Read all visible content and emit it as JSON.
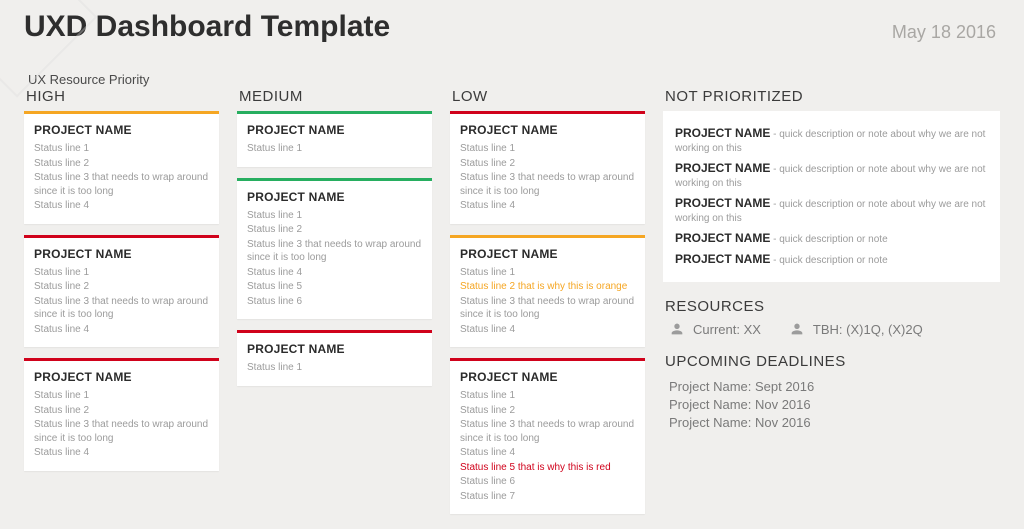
{
  "header": {
    "title": "UXD Dashboard Template",
    "date": "May 18 2016"
  },
  "section_label": "UX Resource Priority",
  "columns": {
    "high": {
      "title": "HIGH",
      "cards": [
        {
          "color": "orange",
          "name": "PROJECT NAME",
          "lines": [
            {
              "t": "Status line 1"
            },
            {
              "t": "Status line 2"
            },
            {
              "t": "Status line 3 that needs to wrap around since it is too long"
            },
            {
              "t": "Status line 4"
            }
          ]
        },
        {
          "color": "red",
          "name": "PROJECT NAME",
          "lines": [
            {
              "t": "Status line 1"
            },
            {
              "t": "Status line 2"
            },
            {
              "t": "Status line 3 that needs to wrap around since it is too long"
            },
            {
              "t": "Status line 4"
            }
          ]
        },
        {
          "color": "red",
          "name": "PROJECT NAME",
          "lines": [
            {
              "t": "Status line 1"
            },
            {
              "t": "Status line 2"
            },
            {
              "t": "Status line 3 that needs to wrap around since it is too long"
            },
            {
              "t": "Status line 4"
            }
          ]
        }
      ]
    },
    "medium": {
      "title": "MEDIUM",
      "cards": [
        {
          "color": "green",
          "name": "PROJECT NAME",
          "lines": [
            {
              "t": "Status line 1"
            }
          ]
        },
        {
          "color": "green",
          "name": "PROJECT NAME",
          "lines": [
            {
              "t": "Status line 1"
            },
            {
              "t": "Status line 2"
            },
            {
              "t": "Status line 3 that needs to wrap around since it is too long"
            },
            {
              "t": "Status line 4"
            },
            {
              "t": "Status line 5"
            },
            {
              "t": "Status line 6"
            }
          ]
        },
        {
          "color": "red",
          "name": "PROJECT NAME",
          "lines": [
            {
              "t": "Status line 1"
            }
          ]
        }
      ]
    },
    "low": {
      "title": "LOW",
      "cards": [
        {
          "color": "red",
          "name": "PROJECT NAME",
          "lines": [
            {
              "t": "Status line 1"
            },
            {
              "t": "Status line 2"
            },
            {
              "t": "Status line 3 that needs to wrap around since it is too long"
            },
            {
              "t": "Status line 4"
            }
          ]
        },
        {
          "color": "orange",
          "name": "PROJECT NAME",
          "lines": [
            {
              "t": "Status line 1"
            },
            {
              "t": "Status line 2 that is why this is orange",
              "c": "orange"
            },
            {
              "t": "Status line 3 that needs to wrap around since it is too long"
            },
            {
              "t": "Status line 4"
            }
          ]
        },
        {
          "color": "red",
          "name": "PROJECT NAME",
          "lines": [
            {
              "t": "Status line 1"
            },
            {
              "t": "Status line 2"
            },
            {
              "t": "Status line 3 that needs to wrap around since it is too long"
            },
            {
              "t": "Status line 4"
            },
            {
              "t": "Status line 5 that is why this is red",
              "c": "red"
            },
            {
              "t": "Status line 6"
            },
            {
              "t": "Status line 7"
            }
          ]
        }
      ]
    }
  },
  "not_prioritized": {
    "title": "NOT PRIORITIZED",
    "items": [
      {
        "name": "PROJECT NAME",
        "note": " - quick description or note about why we are not working on this"
      },
      {
        "name": "PROJECT NAME",
        "note": " - quick description or note about why we are not working on this"
      },
      {
        "name": "PROJECT NAME",
        "note": " - quick description or note about why we are not working on this"
      },
      {
        "name": "PROJECT NAME",
        "note": " - quick description or note"
      },
      {
        "name": "PROJECT NAME",
        "note": " - quick description or note"
      }
    ]
  },
  "resources": {
    "title": "RESOURCES",
    "current_label": "Current: XX",
    "tbh_label": "TBH: (X)1Q, (X)2Q"
  },
  "deadlines": {
    "title": "UPCOMING DEADLINES",
    "items": [
      "Project Name: Sept 2016",
      "Project Name: Nov 2016",
      "Project Name: Nov 2016"
    ]
  }
}
